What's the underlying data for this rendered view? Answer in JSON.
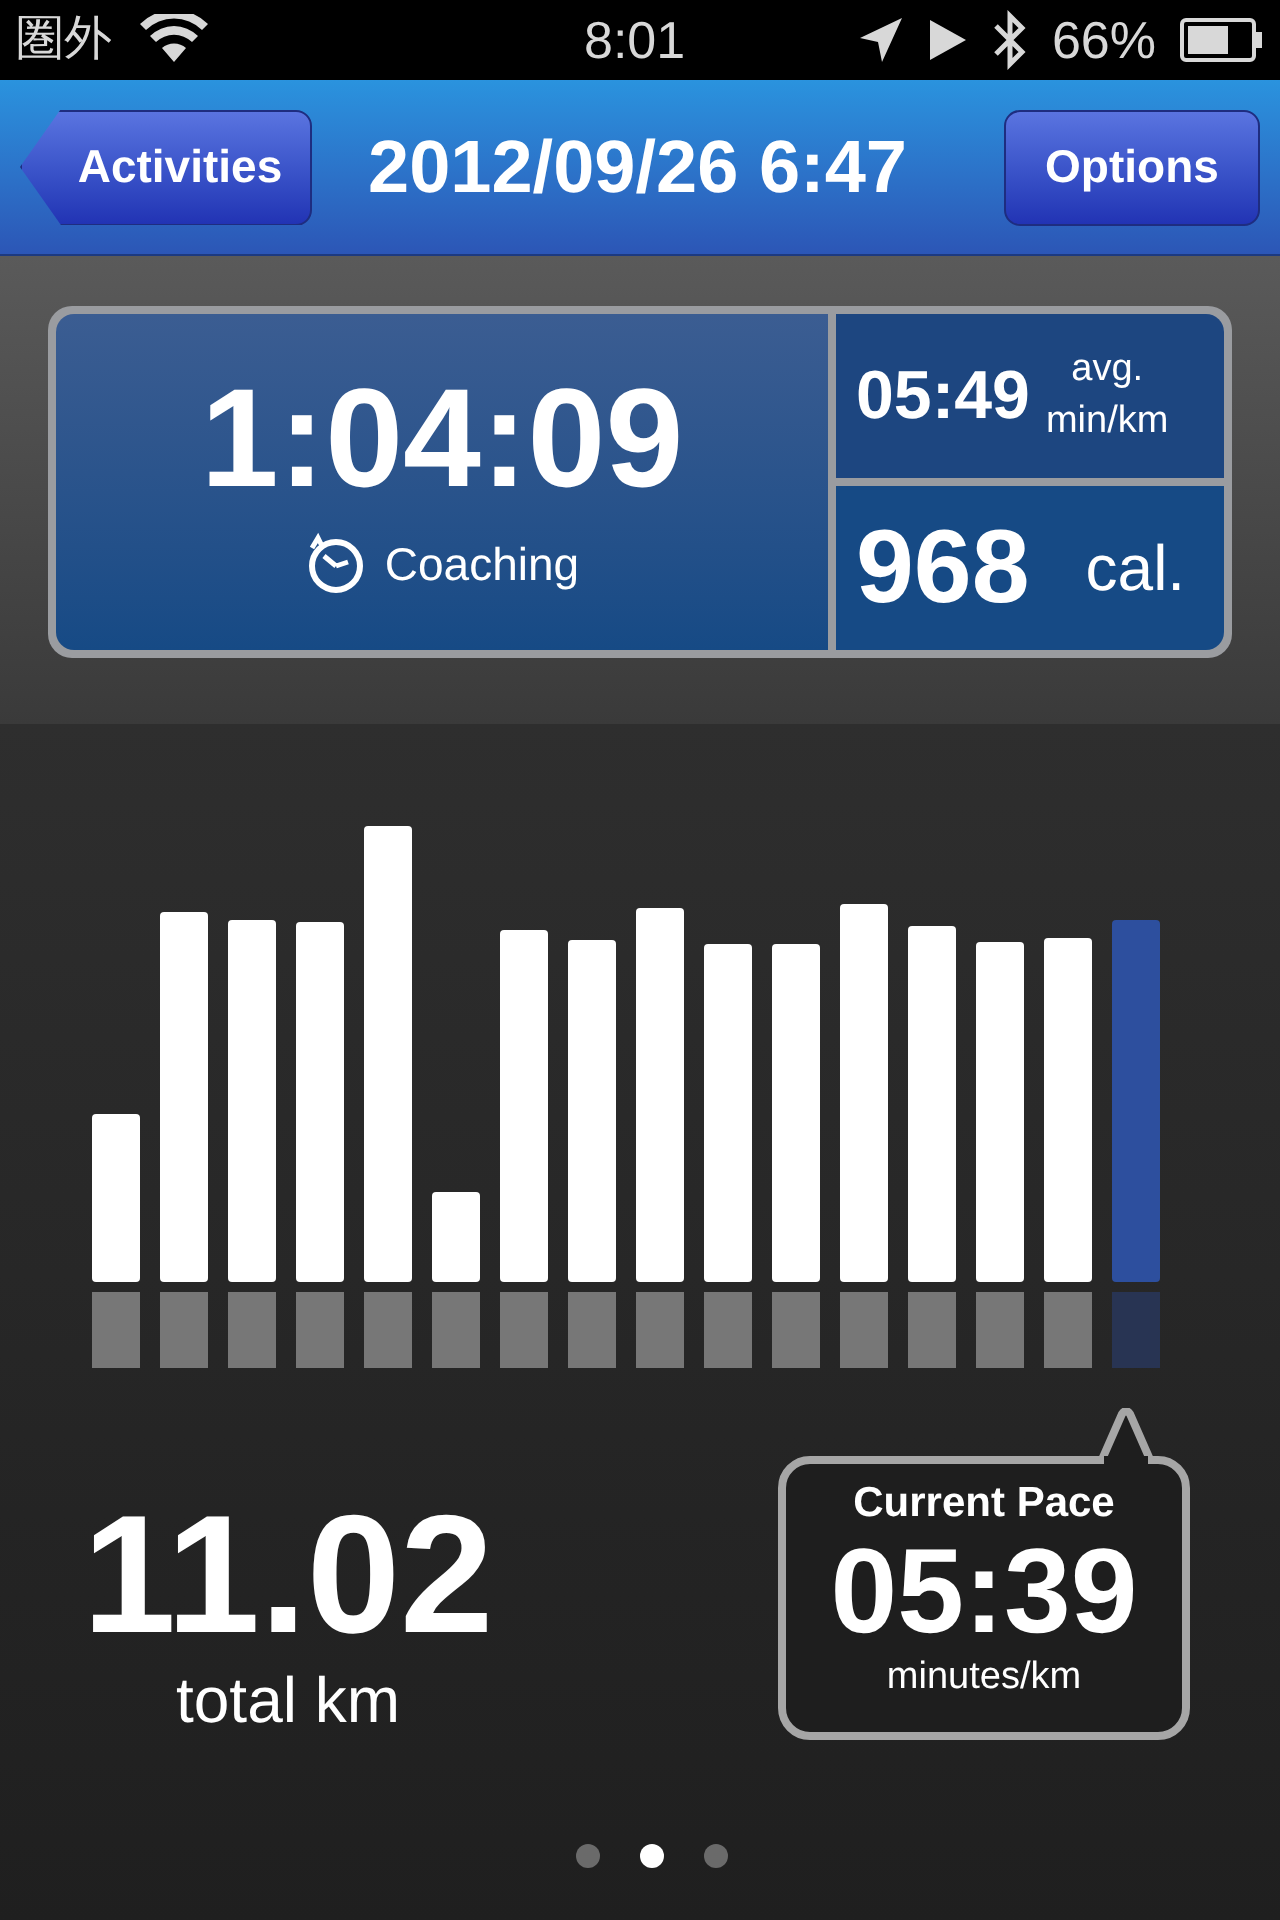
{
  "status_bar": {
    "carrier": "圏外",
    "time": "8:01",
    "battery": "66%"
  },
  "nav": {
    "back": "Activities",
    "title": "2012/09/26 6:47",
    "action": "Options"
  },
  "summary": {
    "duration": "1:04:09",
    "mode": "Coaching",
    "avg_pace": "05:49",
    "avg_label_1": "avg.",
    "avg_label_2": "min/km",
    "calories": "968",
    "calories_unit": "cal."
  },
  "distance": {
    "value": "11.02",
    "unit": "total km"
  },
  "current_pace": {
    "title": "Current Pace",
    "value": "05:39",
    "unit": "minutes/km"
  },
  "page_dots": [
    {
      "selected": false
    },
    {
      "selected": true
    },
    {
      "selected": false
    }
  ]
}
